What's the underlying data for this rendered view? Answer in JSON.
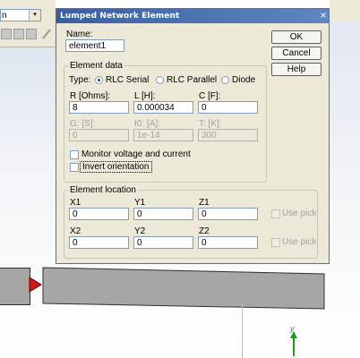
{
  "app": {
    "combo_value": "n",
    "combo_arrow": "▾"
  },
  "dialog": {
    "title": "Lumped Network Element",
    "close": "×",
    "name_label": "Name:",
    "name_value": "element1",
    "buttons": {
      "ok": "OK",
      "cancel": "Cancel",
      "help": "Help"
    },
    "element_data": {
      "legend": "Element data",
      "type_label": "Type:",
      "types": [
        "RLC Serial",
        "RLC Parallel",
        "Diode"
      ],
      "selected_type": "RLC Serial",
      "r_label": "R [Ohms]:",
      "r_value": "8",
      "l_label": "L [H]:",
      "l_value": "0.000034",
      "c_label": "C [F]:",
      "c_value": "0",
      "g_label": "G: [S]:",
      "g_value": "0",
      "i0_label": "I0: [A]:",
      "i0_value": "1e-14",
      "t_label": "T: [K]:",
      "t_value": "300",
      "monitor_label": "Monitor voltage and current",
      "invert_label": "Invert orientation"
    },
    "element_location": {
      "legend": "Element location",
      "x1_label": "X1",
      "x1_value": "0",
      "y1_label": "Y1",
      "y1_value": "0",
      "z1_label": "Z1",
      "z1_value": "0",
      "use_pick_1": "Use pick",
      "x2_label": "X2",
      "x2_value": "0",
      "y2_label": "Y2",
      "y2_value": "0",
      "z2_label": "Z2",
      "z2_value": "0",
      "use_pick_2": "Use pick"
    }
  },
  "axis": {
    "y_label": "y"
  },
  "colors": {
    "titlebar": "#3a5f9c",
    "dialog_bg": "#ece9d8",
    "port_marker": "#d01818",
    "axis_green": "#18a018"
  }
}
